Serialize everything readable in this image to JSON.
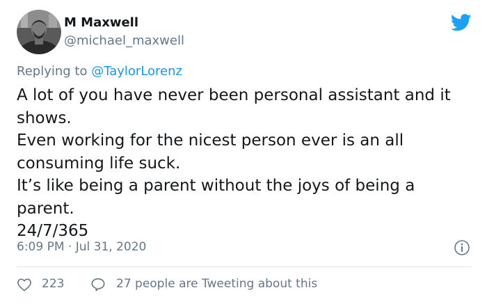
{
  "author": {
    "name": "M Maxwell",
    "handle": "@michael_maxwell"
  },
  "reply": {
    "prefix": "Replying to ",
    "mention": "@TaylorLorenz"
  },
  "tweet": {
    "lines": [
      "A lot of you have never been personal assistant and it",
      "shows.",
      "Even working for the nicest person ever is an all",
      "consuming life suck.",
      "It’s like being a parent without the joys of being a",
      "parent.",
      "24/7/365"
    ],
    "timestamp": "6:09 PM · Jul 31, 2020"
  },
  "stats": {
    "likes": "223",
    "tweeting_about": "27 people are Tweeting about this"
  },
  "icons": {
    "brand": "twitter-bird-icon",
    "info": "info-icon",
    "like": "heart-icon",
    "reply": "speech-bubble-icon"
  },
  "colors": {
    "brand": "#1da1f2",
    "link": "#1b95e0",
    "secondary_text": "#657786",
    "primary_text": "#14171a",
    "divider": "#e1e8ed"
  }
}
